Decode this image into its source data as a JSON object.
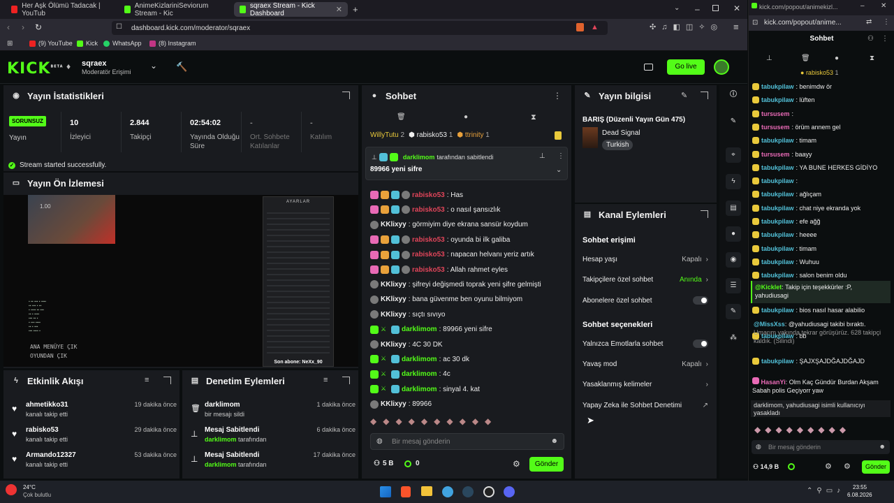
{
  "browser": {
    "tabs": [
      "Her Aşk Ölümü Tadacak | YouTub",
      "AnimeKizlariniSeviorum Stream - Kic",
      "sqraex Stream - Kick Dashboard"
    ],
    "url": "dashboard.kick.com/moderator/sqraex",
    "bookmarks": [
      "(9) YouTube",
      "Kick",
      "WhatsApp",
      "(8) Instagram"
    ],
    "popout_url": "kick.com/popout/animekizl...",
    "popout_url2": "kick.com/popout/anime..."
  },
  "header": {
    "logo": "KICK",
    "beta": "BETA",
    "channel": "sqraex",
    "role": "Moderatör Erişimi",
    "golive": "Go live"
  },
  "stats": {
    "title": "Yayın İstatistikleri",
    "status_badge": "SORUNSUZ",
    "status_label": "Yayın",
    "items": [
      {
        "value": "10",
        "label": "İzleyici"
      },
      {
        "value": "2.844",
        "label": "Takipçi"
      },
      {
        "value": "02:54:02",
        "label": "Yayında Olduğu Süre"
      },
      {
        "value": "-",
        "label": "Ort. Sohbete Katılanlar"
      },
      {
        "value": "-",
        "label": "Katılım"
      }
    ],
    "success": "Stream started successfully."
  },
  "preview": {
    "title": "Yayın Ön İzlemesi",
    "overlay_title": "AYARLAR",
    "overlay_footer": "Son abone: NeXx_90",
    "menu1": "ANA MENÜYE ÇIK",
    "menu2": "OYUNDAN ÇIK",
    "zoom": "1.00"
  },
  "activity": {
    "title": "Etkinlik Akışı",
    "items": [
      {
        "name": "ahmetikko31",
        "sub": "kanalı takip etti",
        "time": "19 dakika önce"
      },
      {
        "name": "rabisko53",
        "sub": "kanalı takip etti",
        "time": "29 dakika önce"
      },
      {
        "name": "Armando12327",
        "sub": "kanalı takip etti",
        "time": "53 dakika önce"
      }
    ]
  },
  "audit": {
    "title": "Denetim Eylemleri",
    "items": [
      {
        "name": "darklimom",
        "sub": "bir mesajı sildi",
        "time": "1 dakika önce"
      },
      {
        "name": "Mesaj Sabitlendi",
        "by": "darklimom",
        "sub": "tarafından",
        "time": "6 dakika önce"
      },
      {
        "name": "Mesaj Sabitlendi",
        "by": "darklimom",
        "sub": "tarafından",
        "time": "17 dakika önce"
      }
    ]
  },
  "chat": {
    "title": "Sohbet",
    "top_gifters": [
      {
        "name": "WillyTutu",
        "n": "2"
      },
      {
        "name": "rabisko53",
        "n": "1"
      },
      {
        "name": "ttrinity",
        "n": "1"
      }
    ],
    "pinned_by": "darklimom",
    "pinned_by_suffix": "tarafından sabitlendi",
    "pinned_msg": "89966 yeni sifre",
    "messages": [
      {
        "user": "rabisko53",
        "text": ": Has",
        "color": "#e0455a",
        "b": "sub"
      },
      {
        "user": "rabisko53",
        "text": ": o nasıl şansızlık",
        "color": "#e0455a",
        "b": "sub"
      },
      {
        "user": "KKlixyy",
        "text": ": görmiyim diye ekrana sansür koydum",
        "color": "#eee",
        "b": "vip"
      },
      {
        "user": "rabisko53",
        "text": ": oyunda bi ilk galiba",
        "color": "#e0455a",
        "b": "sub"
      },
      {
        "user": "rabisko53",
        "text": ": napacan helvanı yeriz artık",
        "color": "#e0455a",
        "b": "sub"
      },
      {
        "user": "rabisko53",
        "text": ": Allah rahmet eyles",
        "color": "#e0455a",
        "b": "sub"
      },
      {
        "user": "KKlixyy",
        "text": ": şifreyi değişmedi toprak yeni şifre gelmişti",
        "color": "#eee",
        "b": "vip"
      },
      {
        "user": "KKlixyy",
        "text": ": bana güvenme ben oyunu bilmiyom",
        "color": "#eee",
        "b": "vip"
      },
      {
        "user": "KKlixyy",
        "text": ": sıçtı sıvıyo",
        "color": "#eee",
        "b": "vip"
      },
      {
        "user": "darklimom",
        "text": ": 89966 yeni sifre",
        "color": "#53fc18",
        "b": "mod"
      },
      {
        "user": "KKlixyy",
        "text": ": 4C 30 DK",
        "color": "#eee",
        "b": "vip"
      },
      {
        "user": "darklimom",
        "text": ": ac 30 dk",
        "color": "#53fc18",
        "b": "mod"
      },
      {
        "user": "darklimom",
        "text": ": 4c",
        "color": "#53fc18",
        "b": "mod"
      },
      {
        "user": "darklimom",
        "text": ": sinyal 4. kat",
        "color": "#53fc18",
        "b": "mod"
      },
      {
        "user": "KKlixyy",
        "text": ": 89966",
        "color": "#eee",
        "b": "vip"
      }
    ],
    "placeholder": "Bir mesaj gönderin",
    "viewers": "5 B",
    "points": "0",
    "send": "Gönder"
  },
  "info": {
    "title": "Yayın bilgisi",
    "stream_title": "BARIŞ (Düzenli Yayın Gün 475)",
    "game": "Dead Signal",
    "lang": "Turkish"
  },
  "actions": {
    "title": "Kanal Eylemleri",
    "access_title": "Sohbet erişimi",
    "account_age": "Hesap yaşı",
    "account_age_v": "Kapalı",
    "followers_only": "Takipçilere özel sohbet",
    "followers_only_v": "Anında",
    "subs_only": "Abonelere özel sohbet",
    "options_title": "Sohbet seçenekleri",
    "emote_only": "Yalnızca Emotlarla sohbet",
    "slow": "Yavaş mod",
    "slow_v": "Kapalı",
    "banned_words": "Yasaklanmış kelimeler",
    "ai_mod": "Yapay Zeka ile Sohbet Denetimi"
  },
  "popout": {
    "title": "Sohbet",
    "gifter": "rabisko53",
    "gifter_n": "1",
    "messages": [
      {
        "user": "tabukpilaw",
        "text": ": benimdw ör",
        "color": "#52c0d8"
      },
      {
        "user": "tabukpilaw",
        "text": ": lüften",
        "color": "#52c0d8"
      },
      {
        "user": "tursusem",
        "text": ":",
        "color": "#e96ab6"
      },
      {
        "user": "tursusem",
        "text": ": örüm annem gel",
        "color": "#e96ab6"
      },
      {
        "user": "tabukpilaw",
        "text": ": timam",
        "color": "#52c0d8"
      },
      {
        "user": "tursusem",
        "text": ": baayy",
        "color": "#e96ab6"
      },
      {
        "user": "tabukpilaw",
        "text": ": YA BUNE HERKES GİDİYO",
        "color": "#52c0d8"
      },
      {
        "user": "tabukpilaw",
        "text": ":",
        "color": "#52c0d8"
      },
      {
        "user": "tabukpilaw",
        "text": ": ağlıçam",
        "color": "#52c0d8"
      },
      {
        "user": "tabukpilaw",
        "text": ": chat niye ekranda yok",
        "color": "#52c0d8"
      },
      {
        "user": "tabukpilaw",
        "text": ": efe ağğ",
        "color": "#52c0d8"
      },
      {
        "user": "tabukpilaw",
        "text": ": heeee",
        "color": "#52c0d8"
      },
      {
        "user": "tabukpilaw",
        "text": ": timam",
        "color": "#52c0d8"
      },
      {
        "user": "tabukpilaw",
        "text": ": Wuhuu",
        "color": "#52c0d8"
      },
      {
        "user": "tabukpilaw",
        "text": ": salon benim oldu",
        "color": "#52c0d8"
      }
    ],
    "kicklet_user": "@Kicklet",
    "kicklet_text": ": Takip için teşekkürler :P,",
    "kicklet_text2": "yahudiusagi",
    "missxs_user": "@MissXss",
    "missxs_text": ": @yahudiusagi takibi bıraktı.",
    "missxs_text2": "Umarım yakında tekrar görüşürüz.",
    "missxs_text3": "628 takipçi kaldık. (Silindi)",
    "more": [
      {
        "user": "tabukpilaw",
        "text": ": bios nasıl hasar alabilio",
        "color": "#52c0d8"
      },
      {
        "user": "tabukpilaw",
        "text": ": bb",
        "color": "#52c0d8"
      },
      {
        "user": "tabukpilaw",
        "text": ": ŞAJXŞAJDĞAJDĞAJD",
        "color": "#52c0d8"
      }
    ],
    "hasan_user": "HasanYi",
    "hasan_text": ": Olm Kaç Gündür Burdan Akşam",
    "hasan_text2": "Sabah polis Geçiyorr yaw",
    "notice": "darklimom, yahudiusagi isimli kullanıcıyı yasakladı",
    "placeholder": "Bir mesaj gönderin",
    "viewers": "14,9 B",
    "send": "Gönder"
  },
  "taskbar": {
    "temp": "24°C",
    "weather": "Çok bulutlu",
    "time": "23:55",
    "date": "6.08.2026"
  }
}
